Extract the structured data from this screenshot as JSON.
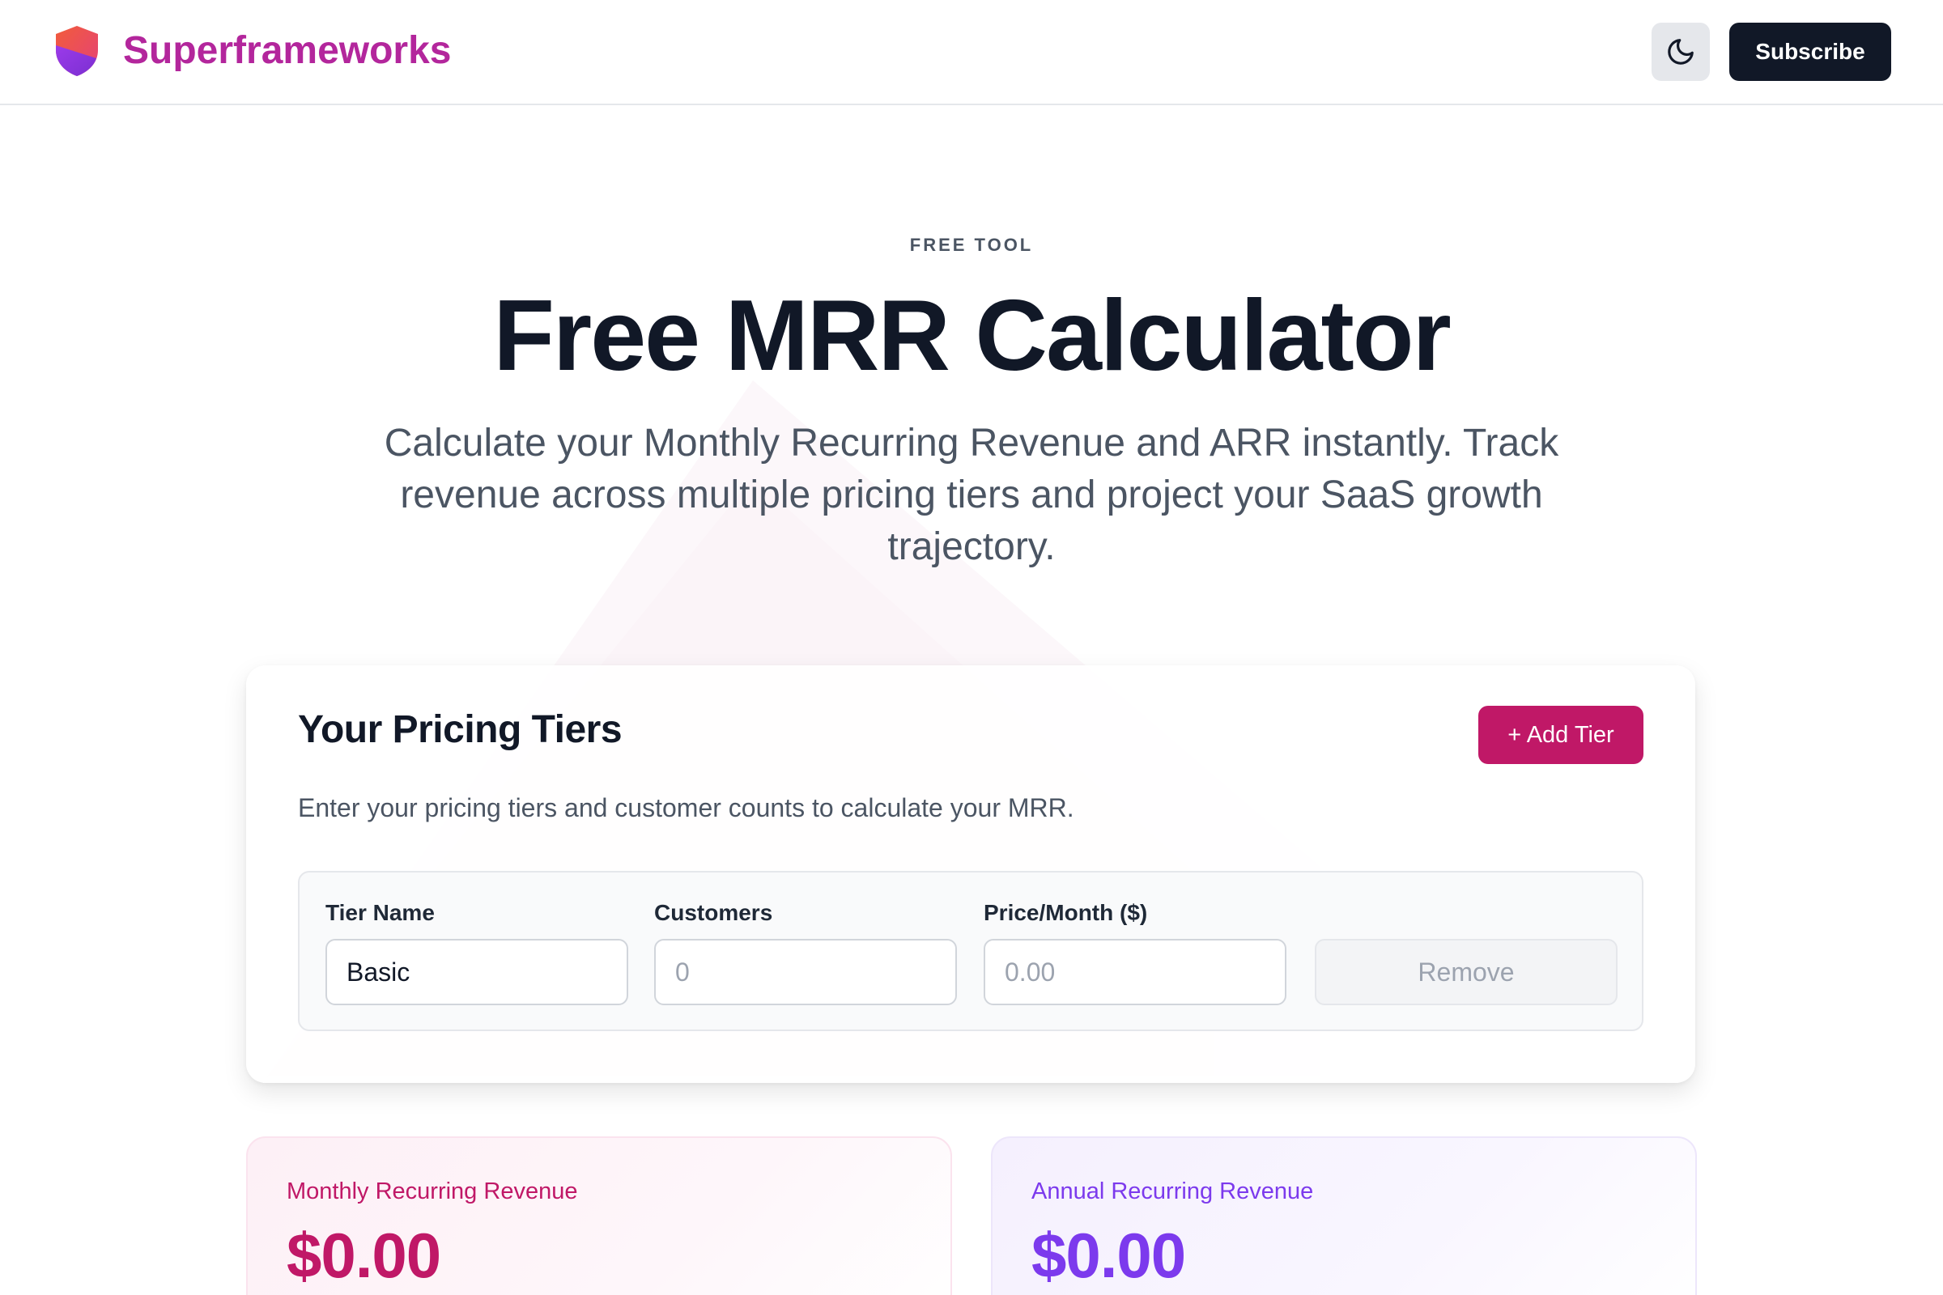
{
  "header": {
    "brand_name": "Superframeworks",
    "subscribe_label": "Subscribe",
    "theme_toggle_icon": "moon-icon"
  },
  "hero": {
    "eyebrow": "FREE TOOL",
    "title": "Free MRR Calculator",
    "subtitle": "Calculate your Monthly Recurring Revenue and ARR instantly. Track revenue across multiple pricing tiers and project your SaaS growth trajectory."
  },
  "pricing": {
    "title": "Your Pricing Tiers",
    "add_tier_label": "+ Add Tier",
    "description": "Enter your pricing tiers and customer counts to calculate your MRR.",
    "tiers": [
      {
        "name_label": "Tier Name",
        "name_value": "Basic",
        "customers_label": "Customers",
        "customers_placeholder": "0",
        "price_label": "Price/Month ($)",
        "price_placeholder": "0.00",
        "remove_label": "Remove"
      }
    ]
  },
  "results": {
    "mrr_label": "Monthly Recurring Revenue",
    "mrr_value": "$0.00",
    "arr_label": "Annual Recurring Revenue",
    "arr_value": "$0.00"
  },
  "colors": {
    "brand_pink": "#c01867",
    "brand_purple": "#7c3aed",
    "dark": "#111827"
  }
}
